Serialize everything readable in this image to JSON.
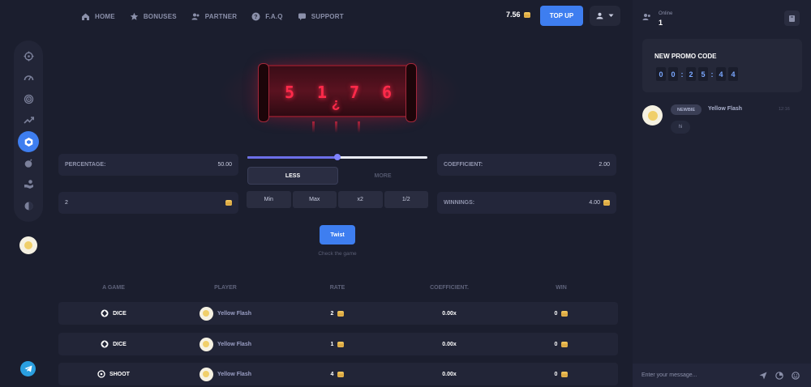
{
  "nav": {
    "items": [
      {
        "label": "HOME",
        "icon": "home-icon",
        "glyph": "⌂"
      },
      {
        "label": "BONUSES",
        "icon": "star-icon",
        "glyph": "★"
      },
      {
        "label": "PARTNER",
        "icon": "users-icon",
        "glyph": "👥"
      },
      {
        "label": "F.A.Q",
        "icon": "question-icon",
        "glyph": "?"
      },
      {
        "label": "SUPPORT",
        "icon": "chat-icon",
        "glyph": "▤"
      }
    ],
    "balance": "7.56",
    "topup_label": "TOP UP"
  },
  "sidebar": {
    "items": [
      {
        "icon": "crosshair-icon",
        "glyph": "⌖"
      },
      {
        "icon": "gauge-icon",
        "glyph": "◠"
      },
      {
        "icon": "target-icon",
        "glyph": "◎"
      },
      {
        "icon": "trend-icon",
        "glyph": "↗"
      },
      {
        "icon": "safe-icon",
        "glyph": "⬢",
        "active": true
      },
      {
        "icon": "bomb-icon",
        "glyph": "●"
      },
      {
        "icon": "hand-coin-icon",
        "glyph": "✋"
      },
      {
        "icon": "wheel-icon",
        "glyph": "◐"
      }
    ]
  },
  "safe": {
    "digits": [
      "5",
      "1",
      "7",
      "6"
    ],
    "question": "¿"
  },
  "controls": {
    "percentage_label": "PERCENTAGE:",
    "percentage_value": "50.00",
    "bet_value": "2",
    "coefficient_label": "COEFFICIENT:",
    "coefficient_value": "2.00",
    "winnings_label": "WINNINGS:",
    "winnings_value": "4.00",
    "slider_fraction": 0.5,
    "less_label": "LESS",
    "more_label": "MORE",
    "mult_buttons": [
      "Min",
      "Max",
      "x2",
      "1/2"
    ],
    "twist_label": "Twist",
    "check_label": "Check the game"
  },
  "table": {
    "headers": [
      "A GAME",
      "PLAYER",
      "RATE",
      "COEFFICIENT.",
      "WIN"
    ],
    "rows": [
      {
        "game": "DICE",
        "player": "Yellow Flash",
        "rate": "2",
        "coef": "0.00x",
        "win": "0"
      },
      {
        "game": "DICE",
        "player": "Yellow Flash",
        "rate": "1",
        "coef": "0.00x",
        "win": "0"
      },
      {
        "game": "SHOOT",
        "player": "Yellow Flash",
        "rate": "4",
        "coef": "0.00x",
        "win": "0"
      }
    ]
  },
  "chat": {
    "online_label": "Online",
    "online_count": "1",
    "promo_title": "NEW PROMO CODE",
    "promo_timer": [
      "0",
      "0",
      "2",
      "5",
      "4",
      "4"
    ],
    "message": {
      "badge": "NEWBIE",
      "name": "Yellow Flash",
      "time": "12:16",
      "text": "hi"
    },
    "input_placeholder": "Enter your message..."
  },
  "colors": {
    "accent": "#3e7ef0",
    "background": "#1b1e2e",
    "safe_digit": "#ff2a4a",
    "slider": "#6c6fe8"
  }
}
